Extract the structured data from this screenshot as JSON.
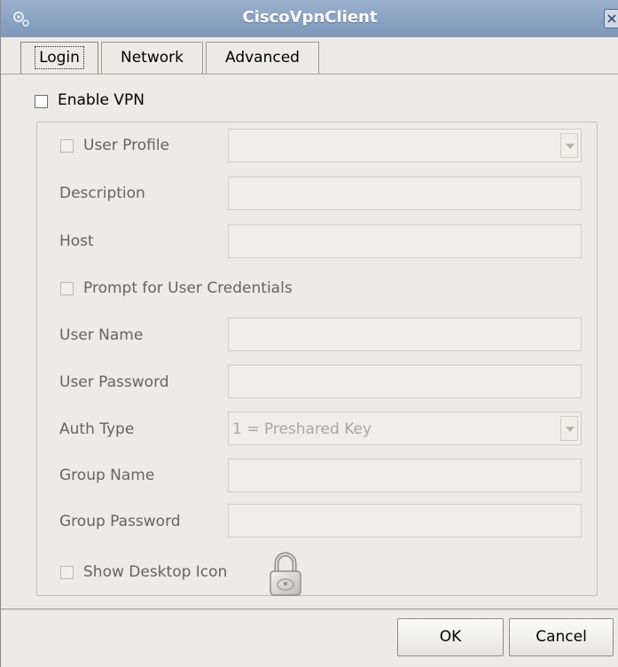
{
  "window": {
    "title": "CiscoVpnClient"
  },
  "tabs": [
    {
      "label": "Login",
      "active": true
    },
    {
      "label": "Network",
      "active": false
    },
    {
      "label": "Advanced",
      "active": false
    }
  ],
  "login": {
    "enable_vpn_label": "Enable VPN",
    "enable_vpn_checked": false,
    "user_profile_label": "User Profile",
    "user_profile_value": "",
    "description_label": "Description",
    "description_value": "",
    "host_label": "Host",
    "host_value": "",
    "prompt_credentials_label": "Prompt for User Credentials",
    "user_name_label": "User Name",
    "user_name_value": "",
    "user_password_label": "User Password",
    "user_password_value": "",
    "auth_type_label": "Auth Type",
    "auth_type_value": "1 = Preshared Key",
    "group_name_label": "Group Name",
    "group_name_value": "",
    "group_password_label": "Group Password",
    "group_password_value": "",
    "show_desktop_icon_label": "Show Desktop Icon"
  },
  "buttons": {
    "ok_label": "OK",
    "cancel_label": "Cancel"
  },
  "icons": {
    "app": "gears-icon",
    "close": "close-icon",
    "lock": "lock-icon",
    "dropdown": "chevron-down-icon"
  },
  "colors": {
    "titlebar": "#8aa1c2",
    "window_bg": "#ecebe8",
    "disabled_text": "#656462"
  }
}
